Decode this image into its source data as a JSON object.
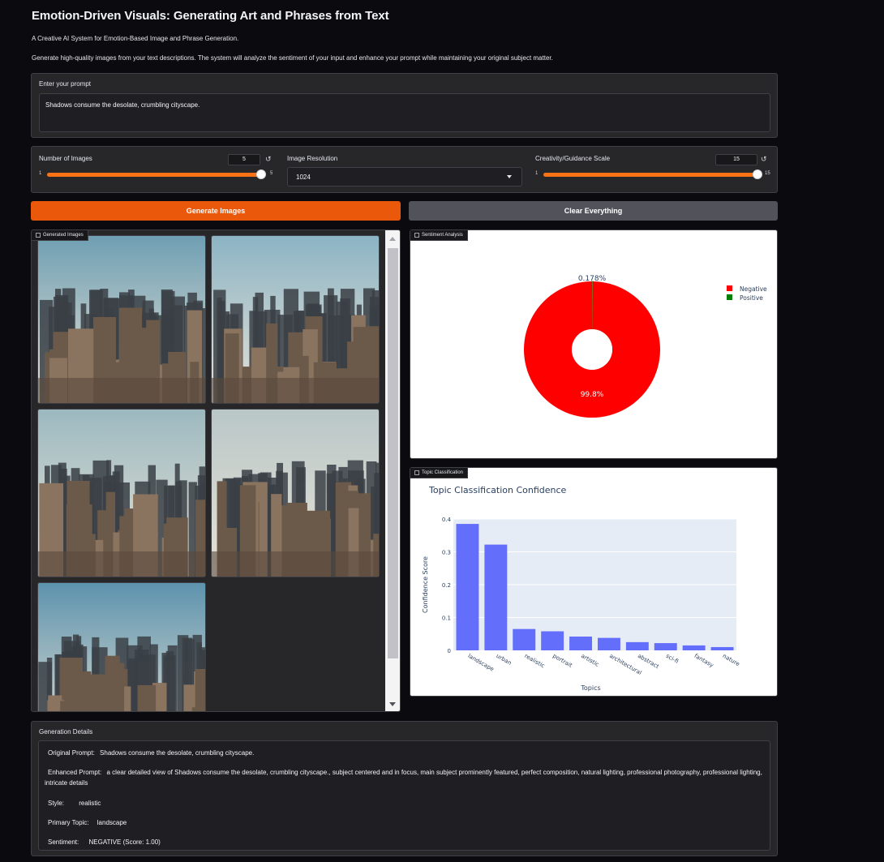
{
  "header": {
    "title": "Emotion-Driven Visuals: Generating Art and Phrases from Text",
    "subtitle": "A Creative AI System for Emotion-Based Image and Phrase Generation.",
    "description": "Generate high-quality images from your text descriptions. The system will analyze the sentiment of your input and enhance your prompt while maintaining your original subject matter."
  },
  "prompt": {
    "label": "Enter your prompt",
    "value": "Shadows consume the desolate, crumbling cityscape."
  },
  "controls": {
    "num_images": {
      "label": "Number of Images",
      "value": "5",
      "min": "1",
      "max": "5",
      "fraction": 1.0
    },
    "resolution": {
      "label": "Image Resolution",
      "value": "1024"
    },
    "guidance": {
      "label": "Creativity/Guidance Scale",
      "value": "15",
      "min": "1",
      "max": "15",
      "fraction": 1.0
    },
    "reset_glyph": "↺"
  },
  "buttons": {
    "generate": "Generate Images",
    "clear": "Clear Everything"
  },
  "gallery": {
    "label": "Generated Images",
    "images": [
      {
        "icon": "cityscape-image",
        "sky": "#6f9fb3"
      },
      {
        "icon": "cityscape-image",
        "sky": "#8cb4c4"
      },
      {
        "icon": "cityscape-image",
        "sky": "#9cb9c0"
      },
      {
        "icon": "cityscape-image",
        "sky": "#b9c7c7"
      },
      {
        "icon": "cityscape-image",
        "sky": "#5d93ad"
      }
    ]
  },
  "sentiment": {
    "label": "Sentiment Analysis",
    "chart_data": {
      "type": "pie",
      "labels": [
        "Negative",
        "Positive"
      ],
      "values": [
        99.8,
        0.178
      ],
      "value_labels": [
        "99.8%",
        "0.178%"
      ],
      "colors": [
        "#ff0000",
        "#008000"
      ],
      "hole": true,
      "legend": "top-right"
    }
  },
  "topic": {
    "label": "Topic Classification",
    "chart_data": {
      "type": "bar",
      "title": "Topic Classification Confidence",
      "xlabel": "Topics",
      "ylabel": "Confidence Score",
      "categories": [
        "landscape",
        "urban",
        "realistic",
        "portrait",
        "artistic",
        "architectural",
        "abstract",
        "sci-fi",
        "fantasy",
        "nature"
      ],
      "values": [
        0.385,
        0.322,
        0.065,
        0.058,
        0.042,
        0.038,
        0.025,
        0.022,
        0.015,
        0.01
      ],
      "yticks": [
        "0",
        "0.1",
        "0.2",
        "0.3",
        "0.4"
      ],
      "ylim": [
        0,
        0.4
      ],
      "color": "#636efa",
      "grid": true
    }
  },
  "details": {
    "label": "Generation Details",
    "original_key": "Original Prompt:",
    "original_value": "Shadows consume the desolate, crumbling cityscape.",
    "enhanced_key": "Enhanced Prompt:",
    "enhanced_value": "a clear detailed view of Shadows consume the desolate, crumbling cityscape., subject centered and in focus, main subject prominently featured, perfect composition, natural lighting, professional photography, professional lighting, intricate details",
    "style_key": "Style:",
    "style_value": "realistic",
    "topic_key": "Primary Topic:",
    "topic_value": "landscape",
    "sentiment_key": "Sentiment:",
    "sentiment_value": "NEGATIVE (Score: 1.00)"
  }
}
